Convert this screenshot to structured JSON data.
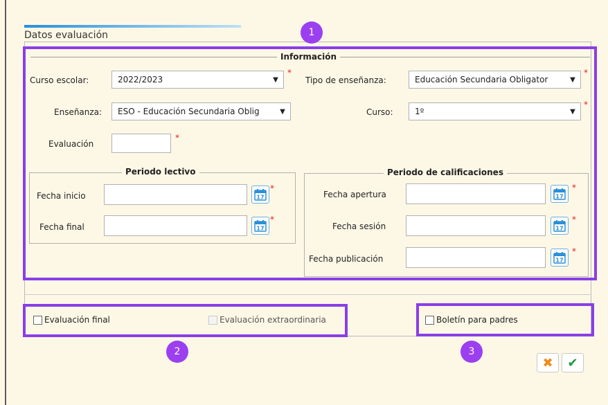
{
  "title": "Datos evaluación",
  "callouts": [
    "1",
    "2",
    "3"
  ],
  "informacion": {
    "legend": "Información",
    "curso_escolar": {
      "label": "Curso escolar:",
      "value": "2022/2023"
    },
    "tipo_ensenanza": {
      "label": "Tipo de enseñanza:",
      "value": "Educación Secundaria Obligator"
    },
    "ensenanza": {
      "label": "Enseñanza:",
      "value": "ESO - Educación Secundaria Oblig"
    },
    "curso": {
      "label": "Curso:",
      "value": "1º"
    },
    "evaluacion": {
      "label": "Evaluación",
      "value": ""
    },
    "required_mark": "*"
  },
  "periodo_lectivo": {
    "legend": "Periodo lectivo",
    "fecha_inicio": "Fecha inicio",
    "fecha_final": "Fecha final"
  },
  "periodo_calificaciones": {
    "legend": "Periodo de calificaciones",
    "fecha_apertura": "Fecha apertura",
    "fecha_sesion": "Fecha sesión",
    "fecha_publicacion": "Fecha publicación"
  },
  "calendar_day": "17",
  "checkboxes": {
    "evaluacion_final": "Evaluación final",
    "evaluacion_extraordinaria": "Evaluación extraordinaria",
    "boletin_padres": "Boletín para padres"
  },
  "buttons": {
    "cancel_icon": "✖",
    "accept_icon": "✔"
  },
  "colors": {
    "highlight": "#8a3ee6",
    "accent": "#2a8fd8",
    "cancel": "#f08a1c",
    "accept": "#1e9a3c"
  }
}
